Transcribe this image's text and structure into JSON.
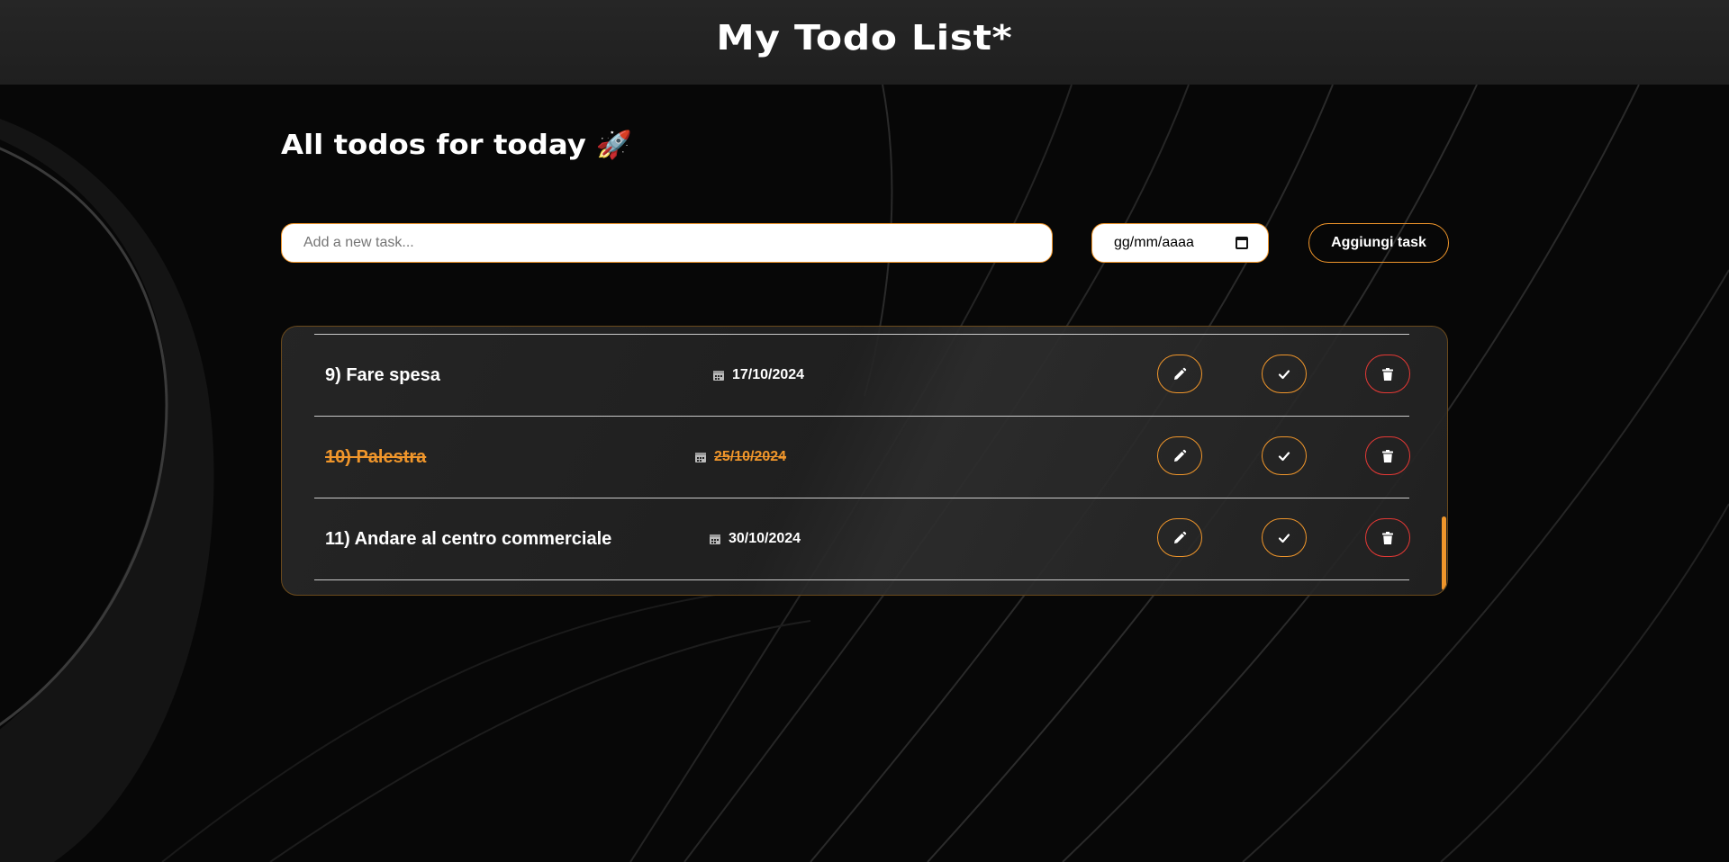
{
  "header": {
    "title": "My Todo List*"
  },
  "main": {
    "heading": "All todos for today",
    "heading_emoji": "🚀"
  },
  "form": {
    "task_placeholder": "Add a new task...",
    "date_placeholder": "gg/mm/aaaa",
    "add_label": "Aggiungi task"
  },
  "todos": [
    {
      "title": "9) Fare spesa",
      "date": "17/10/2024",
      "completed": false
    },
    {
      "title": "10) Palestra",
      "date": "25/10/2024",
      "completed": true
    },
    {
      "title": "11) Andare al centro commerciale",
      "date": "30/10/2024",
      "completed": false
    }
  ],
  "colors": {
    "accent": "#f0962b",
    "danger": "#e53935",
    "background": "#060606",
    "header": "#232323"
  },
  "icons": {
    "edit": "pencil-icon",
    "complete": "check-icon",
    "delete": "trash-icon",
    "date": "calendar-icon"
  }
}
